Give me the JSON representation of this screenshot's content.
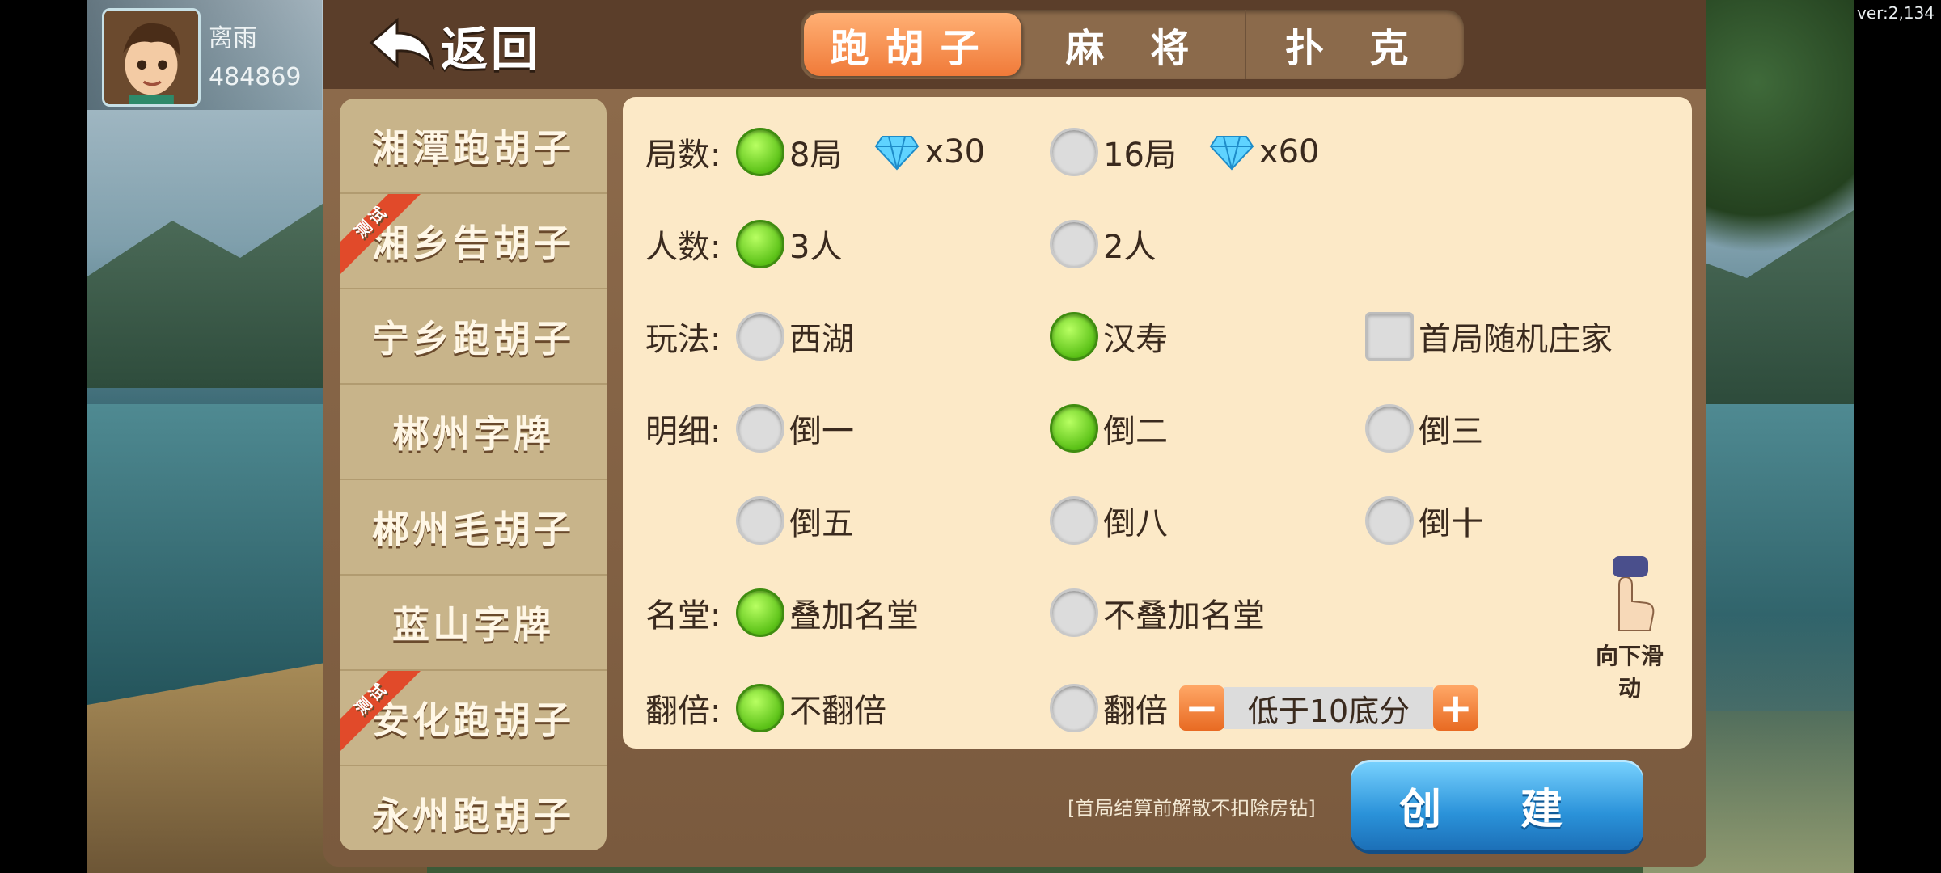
{
  "version": "ver:2,134",
  "user": {
    "name": "离雨",
    "id": "484869"
  },
  "header": {
    "back_label": "返回"
  },
  "tabs": [
    {
      "label": "跑胡子",
      "active": true
    },
    {
      "label": "麻 将",
      "active": false
    },
    {
      "label": "扑 克",
      "active": false
    }
  ],
  "games": [
    {
      "name": "湘潭跑胡子",
      "badge": ""
    },
    {
      "name": "湘乡告胡子",
      "badge": "测试"
    },
    {
      "name": "宁乡跑胡子",
      "badge": ""
    },
    {
      "name": "郴州字牌",
      "badge": ""
    },
    {
      "name": "郴州毛胡子",
      "badge": ""
    },
    {
      "name": "蓝山字牌",
      "badge": ""
    },
    {
      "name": "安化跑胡子",
      "badge": "测试"
    },
    {
      "name": "永州跑胡子",
      "badge": ""
    }
  ],
  "options": {
    "rounds": {
      "label": "局数:",
      "choices": [
        {
          "text": "8局",
          "cost": "x30",
          "selected": true
        },
        {
          "text": "16局",
          "cost": "x60",
          "selected": false
        }
      ]
    },
    "players": {
      "label": "人数:",
      "choices": [
        {
          "text": "3人",
          "selected": true
        },
        {
          "text": "2人",
          "selected": false
        }
      ]
    },
    "mode": {
      "label": "玩法:",
      "choices": [
        {
          "text": "西湖",
          "selected": false
        },
        {
          "text": "汉寿",
          "selected": true
        }
      ],
      "checkbox": {
        "text": "首局随机庄家",
        "checked": false
      }
    },
    "detail": {
      "label": "明细:",
      "choices": [
        {
          "text": "倒一",
          "selected": false
        },
        {
          "text": "倒二",
          "selected": true
        },
        {
          "text": "倒三",
          "selected": false
        },
        {
          "text": "倒五",
          "selected": false
        },
        {
          "text": "倒八",
          "selected": false
        },
        {
          "text": "倒十",
          "selected": false
        }
      ]
    },
    "hall": {
      "label": "名堂:",
      "choices": [
        {
          "text": "叠加名堂",
          "selected": true
        },
        {
          "text": "不叠加名堂",
          "selected": false
        }
      ]
    },
    "double": {
      "label": "翻倍:",
      "choices": [
        {
          "text": "不翻倍",
          "selected": true
        },
        {
          "text": "翻倍",
          "selected": false
        }
      ],
      "stepper_value": "低于10底分"
    }
  },
  "swipe_hint": "向下滑动",
  "note": "[首局结算前解散不扣除房钻]",
  "create_label": "创 建",
  "colors": {
    "tab_active": "#f07a39",
    "radio_on": "#5cc218",
    "create_button": "#2a92d9"
  }
}
